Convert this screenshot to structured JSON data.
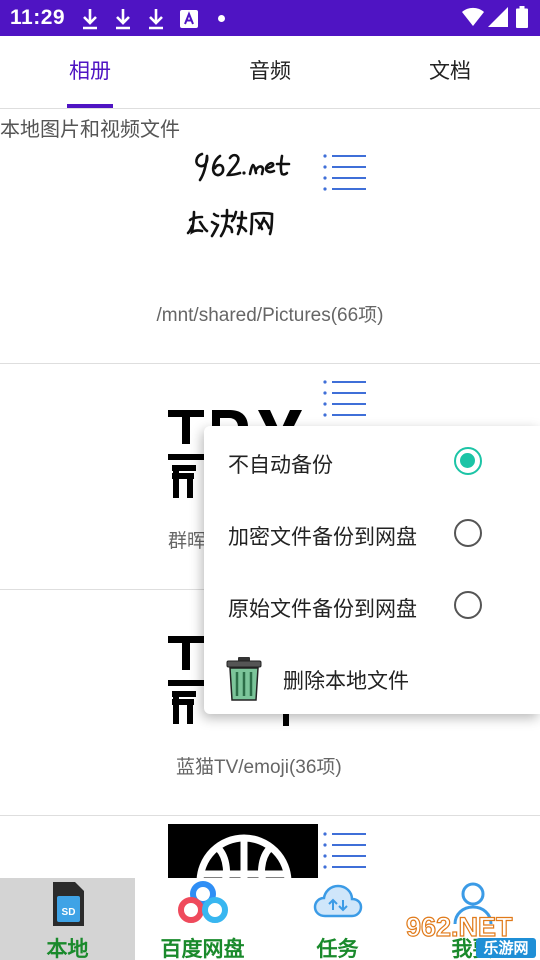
{
  "status_bar": {
    "time": "11:29",
    "icons": [
      "download-icon",
      "download-icon",
      "download-icon",
      "text-a-icon",
      "dot",
      "wifi-icon",
      "signal-icon",
      "battery-icon"
    ]
  },
  "tabs": [
    {
      "label": "相册",
      "active": true
    },
    {
      "label": "音频",
      "active": false
    },
    {
      "label": "文档",
      "active": false
    }
  ],
  "section_label": "本地图片和视频文件",
  "albums": [
    {
      "path": "/mnt/shared/Pictures(66项)",
      "thumb_logo": "962.net 乐游网"
    },
    {
      "path": "群晖"
    },
    {
      "path": "蓝猫TV/emoji(36项)"
    },
    {
      "path": ""
    }
  ],
  "popup_menu": {
    "items": [
      {
        "label": "不自动备份",
        "control": "radio",
        "checked": true
      },
      {
        "label": "加密文件备份到网盘",
        "control": "radio",
        "checked": false
      },
      {
        "label": "原始文件备份到网盘",
        "control": "radio",
        "checked": false
      },
      {
        "label": "删除本地文件",
        "control": "trash-icon"
      }
    ]
  },
  "bottom_nav": [
    {
      "label": "本地",
      "icon": "sd-card-icon",
      "active": true
    },
    {
      "label": "百度网盘",
      "icon": "baidu-netdisk-icon",
      "active": false
    },
    {
      "label": "任务",
      "icon": "cloud-task-icon",
      "active": false
    },
    {
      "label": "我要",
      "icon": "user-icon",
      "active": false
    }
  ],
  "watermark": {
    "text": "962.NET",
    "subtext": "乐游网"
  },
  "colors": {
    "accent": "#4f14c3",
    "radio_checked": "#1cc4a6",
    "nav_label": "#1a8a2c",
    "nav_active_bg": "#d4d4d4"
  }
}
